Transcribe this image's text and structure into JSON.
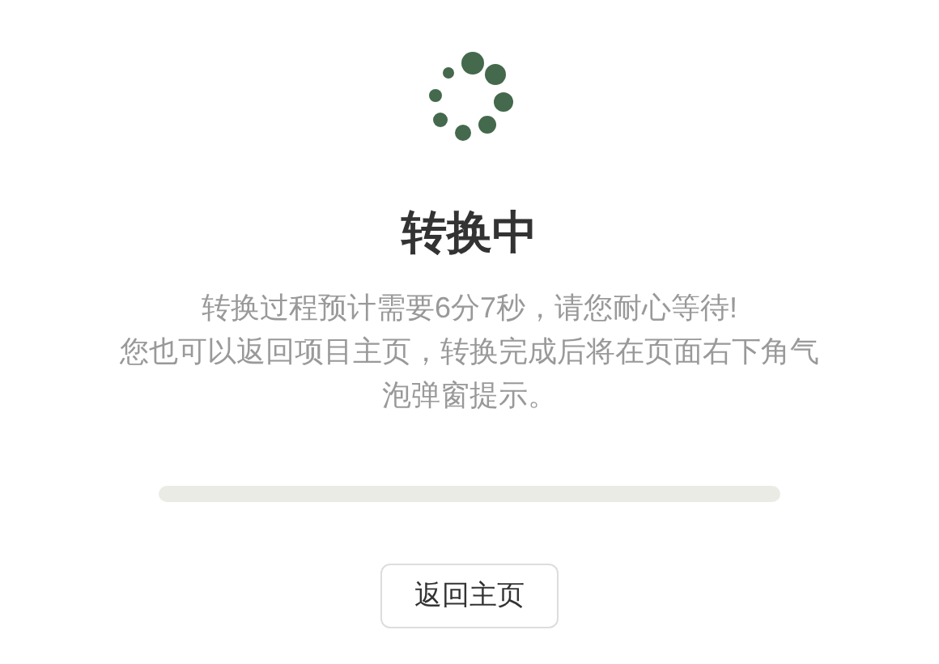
{
  "title": "转换中",
  "messages": [
    "转换过程预计需要6分7秒，请您耐心等待!",
    "您也可以返回项目主页，转换完成后将在页面右下角气泡弹窗提示。"
  ],
  "progress": {
    "level": 0
  },
  "button": "返回主页"
}
